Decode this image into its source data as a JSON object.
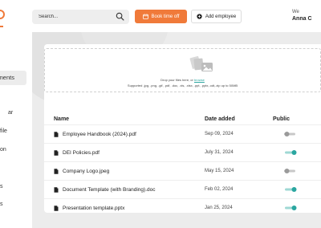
{
  "header": {
    "search_placeholder": "Search...",
    "book_time_off_label": "Book time off",
    "add_employee_label": "Add employee",
    "welcome_text": "We",
    "user_name": "Anna C"
  },
  "sidebar": {
    "items": [
      {
        "label": "ments",
        "active": true
      },
      {
        "label": "ar"
      },
      {
        "label": "file"
      },
      {
        "label": "on"
      },
      {
        "label": "s"
      },
      {
        "label": "s"
      }
    ]
  },
  "upload": {
    "instruction_prefix": "Drop your files here, or",
    "browse_label": "browse",
    "supported": "Supported .jpg, .png, .gif, .pdf, .doc, .xls, .xlsx, .ppt, .pptx,.odt,.zip up to 50MB"
  },
  "table": {
    "headers": {
      "name": "Name",
      "date": "Date added",
      "public": "Public"
    },
    "rows": [
      {
        "name": "Employee Handbook (2024).pdf",
        "date": "Sep 09, 2024",
        "public": false
      },
      {
        "name": "DEI Policies.pdf",
        "date": "July 31, 2024",
        "public": true
      },
      {
        "name": "Company Logo.jpeg",
        "date": "May 15, 2024",
        "public": false
      },
      {
        "name": "Document Template (with Branding).doc",
        "date": "Feb 02, 2024",
        "public": true
      },
      {
        "name": "Presentation template.pptx",
        "date": "Jan 25, 2024",
        "public": true
      }
    ]
  },
  "colors": {
    "accent": "#f07a3a",
    "toggle_on": "#2aa6a0",
    "toggle_off": "#b5b5b5"
  },
  "icons": {
    "search": "search-icon",
    "calendar": "calendar-icon",
    "add": "plus-circle-icon",
    "file": "file-icon",
    "upload": "upload-files-icon"
  }
}
